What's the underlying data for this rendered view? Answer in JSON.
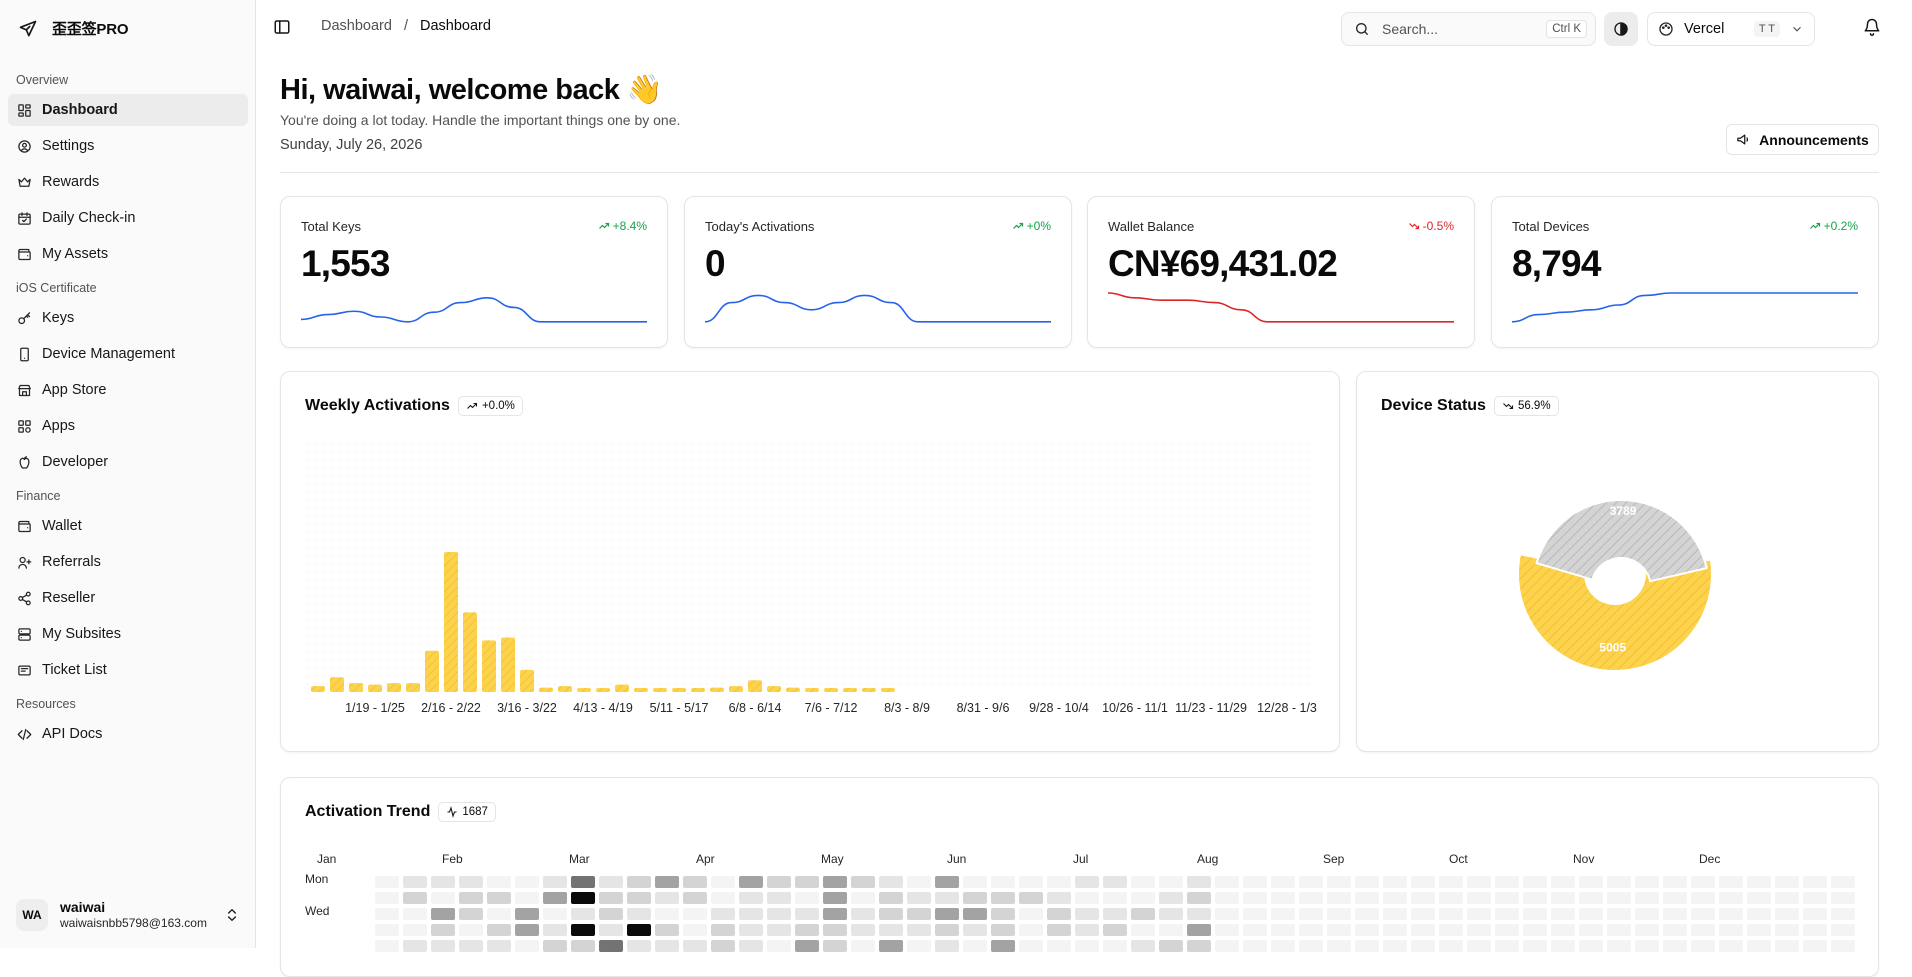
{
  "app": {
    "brand": "歪歪签PRO"
  },
  "sidebar": {
    "groups": [
      {
        "label": "Overview",
        "items": [
          {
            "label": "Dashboard",
            "icon": "layout-dashboard-icon",
            "active": true
          },
          {
            "label": "Settings",
            "icon": "user-circle-icon"
          },
          {
            "label": "Rewards",
            "icon": "crown-icon"
          },
          {
            "label": "Daily Check-in",
            "icon": "calendar-check-icon"
          },
          {
            "label": "My Assets",
            "icon": "wallet-icon"
          }
        ]
      },
      {
        "label": "iOS Certificate",
        "items": [
          {
            "label": "Keys",
            "icon": "key-icon"
          },
          {
            "label": "Device Management",
            "icon": "smartphone-icon"
          },
          {
            "label": "App Store",
            "icon": "store-icon"
          },
          {
            "label": "Apps",
            "icon": "apps-icon"
          },
          {
            "label": "Developer",
            "icon": "apple-icon"
          }
        ]
      },
      {
        "label": "Finance",
        "items": [
          {
            "label": "Wallet",
            "icon": "wallet-icon"
          },
          {
            "label": "Referrals",
            "icon": "user-plus-icon"
          },
          {
            "label": "Reseller",
            "icon": "share-icon"
          },
          {
            "label": "My Subsites",
            "icon": "server-icon"
          },
          {
            "label": "Ticket List",
            "icon": "ticket-icon"
          }
        ]
      },
      {
        "label": "Resources",
        "items": [
          {
            "label": "API Docs",
            "icon": "code-icon"
          }
        ]
      }
    ],
    "user": {
      "initials": "WA",
      "name": "waiwai",
      "email": "waiwaisnbb5798@163.com"
    }
  },
  "header": {
    "breadcrumbs": [
      "Dashboard",
      "Dashboard"
    ],
    "separator": "/",
    "search_placeholder": "Search...",
    "search_kbd": "Ctrl K",
    "team": "Vercel",
    "team_short": "T T"
  },
  "main": {
    "greeting": "Hi, waiwai, welcome back 👋",
    "subtitle": "You're doing a lot today. Handle the important things one by one.",
    "date": "Sunday, July 26, 2026",
    "announcements_label": "Announcements"
  },
  "stats": [
    {
      "label": "Total Keys",
      "value": "1,553",
      "delta": "+8.4%",
      "trend": "up",
      "color": "#2563eb",
      "spark": [
        0.55,
        0.45,
        0.38,
        0.5,
        0.6,
        0.4,
        0.2,
        0.1,
        0.3,
        0.6,
        0.6,
        0.6,
        0.6,
        0.6
      ]
    },
    {
      "label": "Today's Activations",
      "value": "0",
      "delta": "+0%",
      "trend": "up",
      "color": "#2563eb",
      "spark": [
        0.6,
        0.2,
        0.05,
        0.2,
        0.35,
        0.2,
        0.05,
        0.2,
        0.6,
        0.6,
        0.6,
        0.6,
        0.6,
        0.6
      ]
    },
    {
      "label": "Wallet Balance",
      "value": "CN¥69,431.02",
      "delta": "-0.5%",
      "trend": "down",
      "color": "#dc2626",
      "spark": [
        0.0,
        0.1,
        0.15,
        0.15,
        0.2,
        0.35,
        0.6,
        0.6,
        0.6,
        0.6,
        0.6,
        0.6,
        0.6,
        0.6
      ]
    },
    {
      "label": "Total Devices",
      "value": "8,794",
      "delta": "+0.2%",
      "trend": "up",
      "color": "#2563eb",
      "spark": [
        0.6,
        0.45,
        0.4,
        0.35,
        0.25,
        0.05,
        0.0,
        0.0,
        0.0,
        0.0,
        0.0,
        0.0,
        0.0,
        0.0
      ]
    }
  ],
  "weekly": {
    "title": "Weekly Activations",
    "badge": "+0.0%"
  },
  "device_status": {
    "title": "Device Status",
    "badge": "56.9%"
  },
  "trend": {
    "title": "Activation Trend",
    "badge": "1687",
    "months": [
      "Jan",
      "Feb",
      "Mar",
      "Apr",
      "May",
      "Jun",
      "Jul",
      "Aug",
      "Sep",
      "Oct",
      "Nov",
      "Dec"
    ],
    "days": [
      "Mon",
      "Wed"
    ]
  },
  "chart_data": [
    {
      "type": "bar",
      "title": "Weekly Activations",
      "tick_labels": [
        "1/19 - 1/25",
        "2/16 - 2/22",
        "3/16 - 3/22",
        "4/13 - 4/19",
        "5/11 - 5/17",
        "6/8 - 6/14",
        "7/6 - 7/12",
        "8/3 - 8/9",
        "8/31 - 9/6",
        "9/28 - 10/4",
        "10/26 - 11/1",
        "11/23 - 11/29",
        "12/28 - 1/3"
      ],
      "values": [
        4,
        10,
        6,
        5,
        6,
        6,
        28,
        95,
        54,
        35,
        37,
        15,
        3,
        4,
        2,
        2,
        5,
        2,
        2,
        2,
        2,
        3,
        4,
        8,
        4,
        3,
        2,
        2,
        2,
        2,
        1,
        0,
        0,
        0,
        0,
        0,
        0,
        0,
        0,
        0,
        0,
        0,
        0,
        0,
        0,
        0,
        0,
        0,
        0,
        0,
        0,
        0,
        0
      ],
      "color": "#fbbf24"
    },
    {
      "type": "pie",
      "title": "Device Status",
      "values": [
        5005,
        3789
      ],
      "colors": [
        "#fbbf24",
        "#a3a3a3"
      ],
      "labels": [
        "5005",
        "3789"
      ]
    },
    {
      "type": "heatmap",
      "title": "Activation Trend"
    }
  ]
}
